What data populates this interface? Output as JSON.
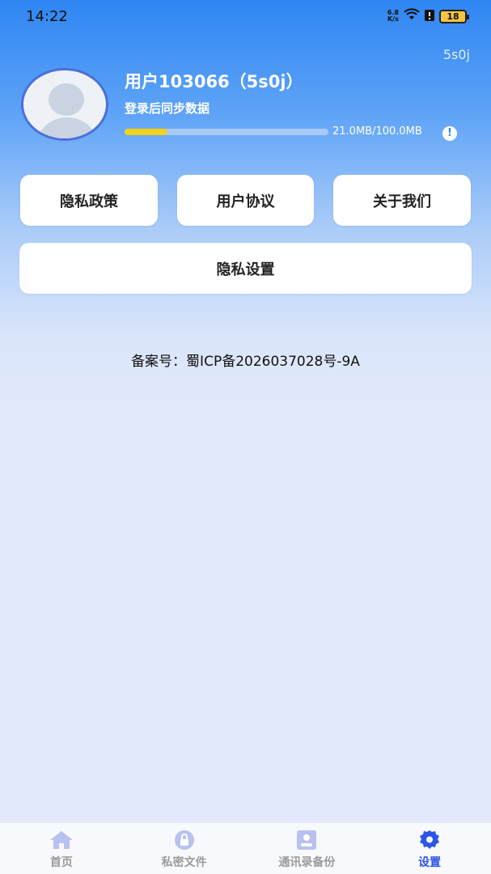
{
  "status_bar": {
    "time": "14:22",
    "net_speed_value": "6.8",
    "net_speed_unit": "K/s",
    "battery": "18"
  },
  "device_code": "5s0j",
  "profile": {
    "username": "用户103066（5s0j）",
    "sync_hint": "登录后同步数据",
    "storage_text": "21.0MB/100.0MB",
    "storage_used_fraction": 0.21,
    "info_icon": "!"
  },
  "buttons": {
    "privacy_policy": "隐私政策",
    "user_agreement": "用户协议",
    "about_us": "关于我们",
    "privacy_settings": "隐私设置"
  },
  "icp_record": "备案号：蜀ICP备2026037028号-9A",
  "bottom_nav": {
    "items": [
      {
        "label": "首页",
        "icon": "home-icon"
      },
      {
        "label": "私密文件",
        "icon": "lock-icon"
      },
      {
        "label": "通讯录备份",
        "icon": "contacts-icon"
      },
      {
        "label": "设置",
        "icon": "gear-icon"
      }
    ],
    "active_index": 3
  },
  "colors": {
    "accent": "#2b55e6",
    "header_blue": "#2f86f2",
    "storage_fill": "#f2d21b",
    "inactive_nav": "#9a9a9a"
  }
}
